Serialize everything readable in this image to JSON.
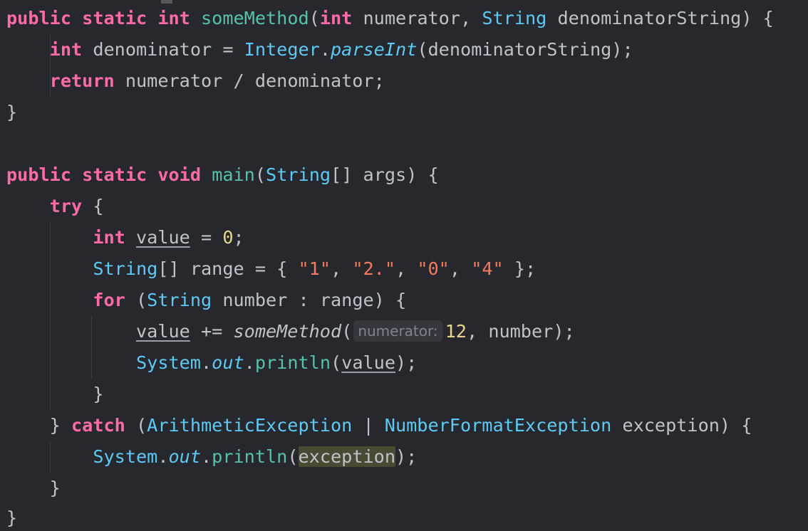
{
  "code": {
    "kw_public": "public",
    "kw_static": "static",
    "kw_int": "int",
    "kw_void": "void",
    "kw_return": "return",
    "kw_try": "try",
    "kw_for": "for",
    "kw_catch": "catch",
    "some_method": "someMethod",
    "main_method": "main",
    "type_string": "String",
    "type_integer": "Integer",
    "type_system": "System",
    "type_arith_ex": "ArithmeticException",
    "type_numfmt_ex": "NumberFormatException",
    "parse_int": "parseInt",
    "out_field": "out",
    "println": "println",
    "var_numerator": "numerator",
    "var_denominator_string": "denominatorString",
    "var_denominator": "denominator",
    "var_args": "args",
    "var_value": "value",
    "var_range": "range",
    "var_number": "number",
    "var_exception": "exception",
    "num_zero": "0",
    "num_twelve": "12",
    "str_1": "\"1\"",
    "str_2": "\"2.\"",
    "str_0": "\"0\"",
    "str_4": "\"4\"",
    "param_hint": "numerator:"
  }
}
